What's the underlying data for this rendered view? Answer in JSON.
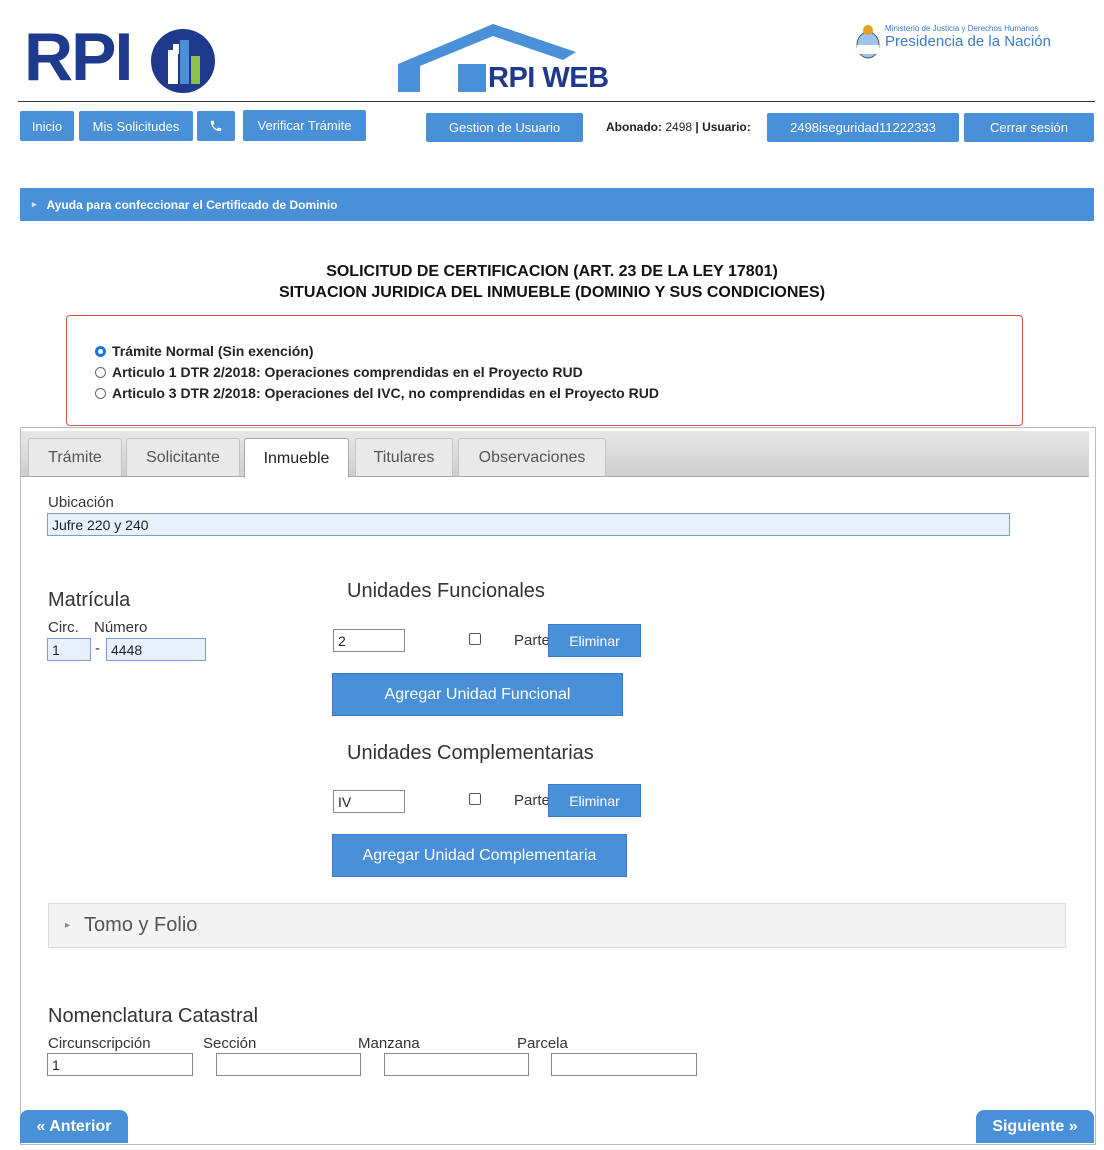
{
  "header": {
    "logo_text": "RPI",
    "rpiweb_text": "RPI WEB",
    "ministry_small": "Ministerio de Justicia y Derechos Humanos",
    "ministry_big": "Presidencia de la Nación"
  },
  "nav": {
    "inicio": "Inicio",
    "mis_solicitudes": "Mis Solicitudes",
    "phone_icon": "phone-icon",
    "verificar": "Verificar Trámite",
    "gestion": "Gestion de Usuario",
    "abonado_label": "Abonado:",
    "abonado_value": "2498",
    "usuario_label": "| Usuario:",
    "usuario_value": "2498iseguridad11222333",
    "cerrar": "Cerrar sesión"
  },
  "help_bar": "Ayuda para confeccionar el Certificado de Dominio",
  "title_line1": "SOLICITUD DE CERTIFICACION (ART. 23 DE LA LEY 17801)",
  "title_line2": "SITUACION JURIDICA DEL INMUEBLE (DOMINIO Y SUS CONDICIONES)",
  "exemption": {
    "options": [
      {
        "label": "Trámite Normal (Sin exención)",
        "checked": true
      },
      {
        "label": "Articulo 1 DTR 2/2018: Operaciones comprendidas en el Proyecto RUD",
        "checked": false
      },
      {
        "label": "Articulo 3 DTR 2/2018: Operaciones del IVC, no comprendidas en el Proyecto RUD",
        "checked": false
      }
    ]
  },
  "tabs": [
    "Trámite",
    "Solicitante",
    "Inmueble",
    "Titulares",
    "Observaciones"
  ],
  "active_tab": "Inmueble",
  "inmueble": {
    "ubicacion_label": "Ubicación",
    "ubicacion_value": "Jufre 220 y 240",
    "matricula_label": "Matrícula",
    "circ_label": "Circ.",
    "numero_label": "Número",
    "circ_value": "1",
    "sep": "-",
    "numero_value": "4448",
    "uf_title": "Unidades Funcionales",
    "uf_value": "2",
    "parte_label": "Parte",
    "eliminar": "Eliminar",
    "agregar_uf": "Agregar Unidad Funcional",
    "uc_title": "Unidades Complementarias",
    "uc_value": "IV",
    "agregar_uc": "Agregar Unidad Complementaria",
    "tomo_folio": "Tomo y Folio",
    "nomenclatura_title": "Nomenclatura Catastral",
    "circunscripcion_label": "Circunscripción",
    "seccion_label": "Sección",
    "manzana_label": "Manzana",
    "parcela_label": "Parcela",
    "circunscripcion_value": "1",
    "seccion_value": "",
    "manzana_value": "",
    "parcela_value": ""
  },
  "footer": {
    "anterior": "« Anterior",
    "siguiente": "Siguiente »"
  },
  "colors": {
    "accent": "#4a90d9",
    "brand": "#1f3a8c",
    "alert_border": "#d9534f"
  }
}
